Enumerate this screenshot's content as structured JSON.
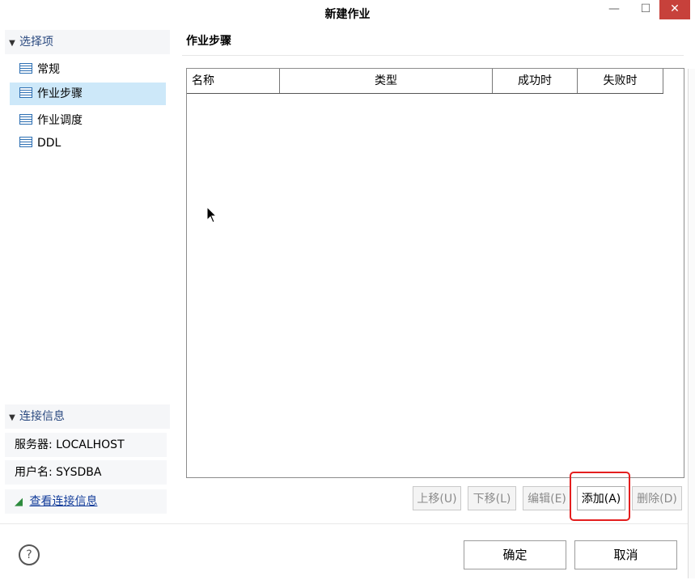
{
  "window": {
    "title": "新建作业",
    "controls": {
      "minimize": "—",
      "maximize": "☐",
      "close": "✕"
    }
  },
  "sidebar": {
    "section_title": "选择项",
    "items": [
      {
        "label": "常规",
        "selected": false
      },
      {
        "label": "作业步骤",
        "selected": true
      },
      {
        "label": "作业调度",
        "selected": false
      },
      {
        "label": "DDL",
        "selected": false
      }
    ],
    "connection": {
      "title": "连接信息",
      "server": "服务器: LOCALHOST",
      "user": "用户名: SYSDBA",
      "view_link": "查看连接信息"
    }
  },
  "main": {
    "title": "作业步骤",
    "table": {
      "columns": [
        "名称",
        "类型",
        "成功时",
        "失败时"
      ],
      "rows": []
    },
    "buttons": {
      "up": "上移(U)",
      "down": "下移(L)",
      "edit": "编辑(E)",
      "add": "添加(A)",
      "delete": "删除(D)"
    }
  },
  "footer": {
    "help": "?",
    "ok": "确定",
    "cancel": "取消"
  },
  "colors": {
    "selected_bg": "#cde8f9",
    "highlight": "#e41e1e",
    "close_bg": "#c7413b"
  }
}
